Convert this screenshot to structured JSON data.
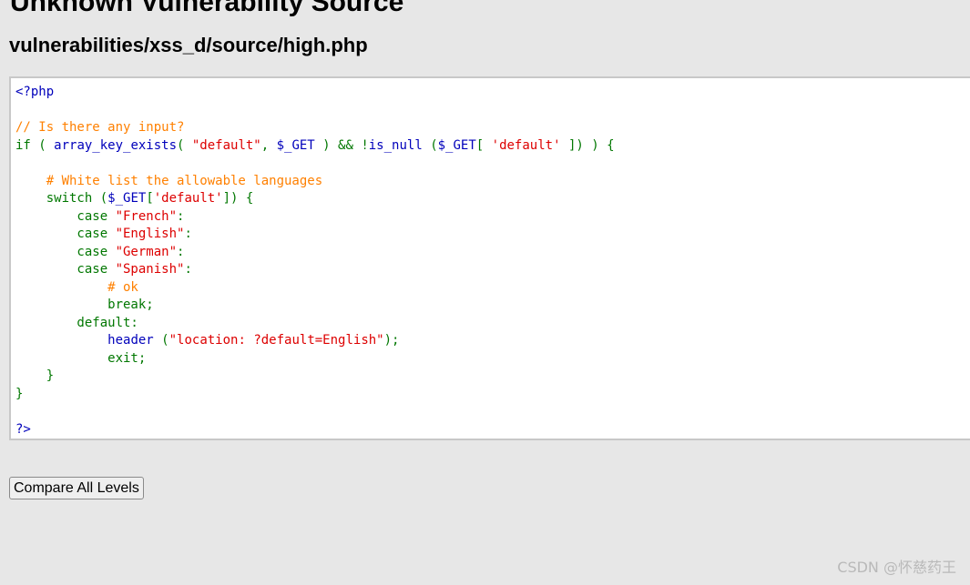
{
  "page": {
    "title": "Unknown Vulnerability Source",
    "file_path": "vulnerabilities/xss_d/source/high.php"
  },
  "colors": {
    "background": "#e7e7e7",
    "code_background": "#ffffff",
    "code_keyword": "#007700",
    "code_default": "#0000bb",
    "code_string": "#dd0000",
    "code_comment": "#ff8000"
  },
  "code": {
    "lines": [
      [
        {
          "t": "<?php",
          "c": "code_default"
        }
      ],
      [],
      [
        {
          "t": "// Is there any input?",
          "c": "code_comment"
        }
      ],
      [
        {
          "t": "if ( ",
          "c": "code_keyword"
        },
        {
          "t": "array_key_exists",
          "c": "code_default"
        },
        {
          "t": "( ",
          "c": "code_keyword"
        },
        {
          "t": "\"default\"",
          "c": "code_string"
        },
        {
          "t": ", ",
          "c": "code_keyword"
        },
        {
          "t": "$_GET ",
          "c": "code_default"
        },
        {
          "t": ") && !",
          "c": "code_keyword"
        },
        {
          "t": "is_null ",
          "c": "code_default"
        },
        {
          "t": "(",
          "c": "code_keyword"
        },
        {
          "t": "$_GET",
          "c": "code_default"
        },
        {
          "t": "[ ",
          "c": "code_keyword"
        },
        {
          "t": "'default' ",
          "c": "code_string"
        },
        {
          "t": "]) ) {",
          "c": "code_keyword"
        }
      ],
      [],
      [
        {
          "t": "    # White list the allowable languages",
          "c": "code_comment"
        }
      ],
      [
        {
          "t": "    switch (",
          "c": "code_keyword"
        },
        {
          "t": "$_GET",
          "c": "code_default"
        },
        {
          "t": "[",
          "c": "code_keyword"
        },
        {
          "t": "'default'",
          "c": "code_string"
        },
        {
          "t": "]) {",
          "c": "code_keyword"
        }
      ],
      [
        {
          "t": "        case ",
          "c": "code_keyword"
        },
        {
          "t": "\"French\"",
          "c": "code_string"
        },
        {
          "t": ":",
          "c": "code_keyword"
        }
      ],
      [
        {
          "t": "        case ",
          "c": "code_keyword"
        },
        {
          "t": "\"English\"",
          "c": "code_string"
        },
        {
          "t": ":",
          "c": "code_keyword"
        }
      ],
      [
        {
          "t": "        case ",
          "c": "code_keyword"
        },
        {
          "t": "\"German\"",
          "c": "code_string"
        },
        {
          "t": ":",
          "c": "code_keyword"
        }
      ],
      [
        {
          "t": "        case ",
          "c": "code_keyword"
        },
        {
          "t": "\"Spanish\"",
          "c": "code_string"
        },
        {
          "t": ":",
          "c": "code_keyword"
        }
      ],
      [
        {
          "t": "            # ok",
          "c": "code_comment"
        }
      ],
      [
        {
          "t": "            break;",
          "c": "code_keyword"
        }
      ],
      [
        {
          "t": "        default:",
          "c": "code_keyword"
        }
      ],
      [
        {
          "t": "            ",
          "c": "code_keyword"
        },
        {
          "t": "header ",
          "c": "code_default"
        },
        {
          "t": "(",
          "c": "code_keyword"
        },
        {
          "t": "\"location: ?default=English\"",
          "c": "code_string"
        },
        {
          "t": ");",
          "c": "code_keyword"
        }
      ],
      [
        {
          "t": "            exit;",
          "c": "code_keyword"
        }
      ],
      [
        {
          "t": "    }",
          "c": "code_keyword"
        }
      ],
      [
        {
          "t": "}",
          "c": "code_keyword"
        }
      ],
      [],
      [
        {
          "t": "?>",
          "c": "code_default"
        }
      ]
    ]
  },
  "buttons": {
    "compare_label": "Compare All Levels"
  },
  "watermark": {
    "text": "CSDN @怀慈药王"
  }
}
